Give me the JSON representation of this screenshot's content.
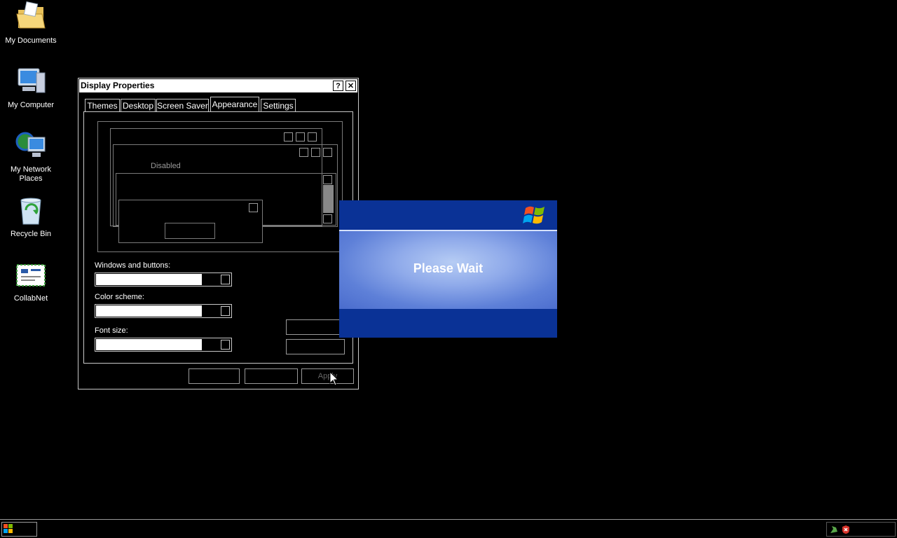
{
  "desktop": {
    "icons": [
      {
        "label": "My Documents",
        "icon": "folder-icon"
      },
      {
        "label": "My Computer",
        "icon": "computer-icon"
      },
      {
        "label": "My Network Places",
        "icon": "network-icon"
      },
      {
        "label": "Recycle Bin",
        "icon": "recycle-bin-icon"
      },
      {
        "label": "CollabNet",
        "icon": "collabnet-icon"
      }
    ]
  },
  "dialog": {
    "title": "Display Properties",
    "help_glyph": "?",
    "close_glyph": "✕",
    "tabs": [
      "Themes",
      "Desktop",
      "Screen Saver",
      "Appearance",
      "Settings"
    ],
    "active_tab": "Appearance",
    "preview": {
      "disabled_label": "Disabled"
    },
    "fields": {
      "windows_buttons_label": "Windows and buttons:",
      "color_scheme_label": "Color scheme:",
      "font_size_label": "Font size:"
    },
    "buttons": {
      "apply": "Apply"
    }
  },
  "splash": {
    "message": "Please Wait",
    "logo": "windows-logo-icon"
  },
  "colors": {
    "splash_dark": "#0a3296",
    "splash_light": "#9fb8ef"
  }
}
